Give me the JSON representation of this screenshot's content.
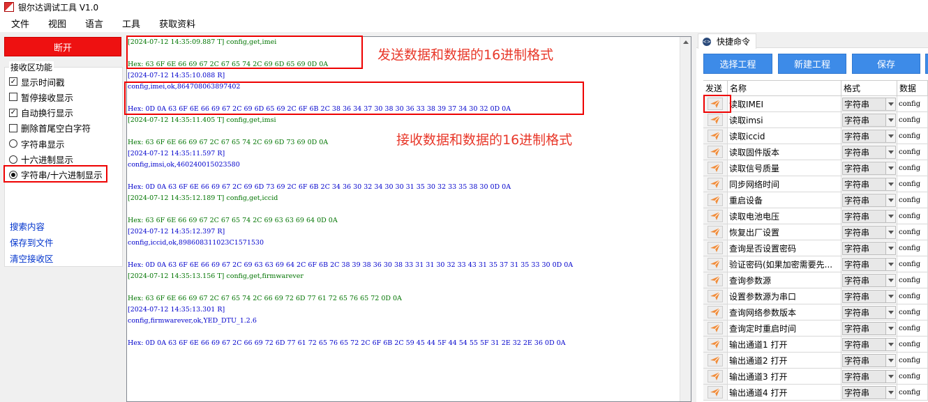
{
  "window": {
    "title": "银尔达调试工具 V1.0"
  },
  "menu": [
    "文件",
    "视图",
    "语言",
    "工具",
    "获取资料"
  ],
  "left": {
    "disconnect_label": "断开",
    "recv_group_title": "接收区功能",
    "options": [
      {
        "kind": "checkbox",
        "label": "显示时间戳",
        "checked": true
      },
      {
        "kind": "checkbox",
        "label": "暂停接收显示",
        "checked": false
      },
      {
        "kind": "checkbox",
        "label": "自动换行显示",
        "checked": true
      },
      {
        "kind": "checkbox",
        "label": "删除首尾空白字符",
        "checked": false
      },
      {
        "kind": "radio",
        "label": "字符串显示",
        "checked": false
      },
      {
        "kind": "radio",
        "label": "十六进制显示",
        "checked": false
      },
      {
        "kind": "radio",
        "label": "字符串/十六进制显示",
        "checked": true
      }
    ],
    "links": [
      "搜索内容",
      "保存到文件",
      "清空接收区"
    ]
  },
  "log": [
    {
      "type": "send",
      "text": "[2024-07-12 14:35:09.887 T] config,get,imei"
    },
    {
      "type": "blank",
      "text": ""
    },
    {
      "type": "send",
      "text": "Hex: 63 6F 6E 66 69 67 2C 67 65 74 2C 69 6D 65 69 0D 0A"
    },
    {
      "type": "recv",
      "text": "[2024-07-12 14:35:10.088 R]"
    },
    {
      "type": "recv",
      "text": "config,imei,ok,864708063897402"
    },
    {
      "type": "blank",
      "text": ""
    },
    {
      "type": "recv",
      "text": "Hex: 0D 0A 63 6F 6E 66 69 67 2C 69 6D 65 69 2C 6F 6B 2C 38 36 34 37 30 38 30 36 33 38 39 37 34 30 32 0D 0A"
    },
    {
      "type": "send",
      "text": "[2024-07-12 14:35:11.405 T] config,get,imsi"
    },
    {
      "type": "blank",
      "text": ""
    },
    {
      "type": "send",
      "text": "Hex: 63 6F 6E 66 69 67 2C 67 65 74 2C 69 6D 73 69 0D 0A"
    },
    {
      "type": "recv",
      "text": "[2024-07-12 14:35:11.597 R]"
    },
    {
      "type": "recv",
      "text": "config,imsi,ok,460240015023580"
    },
    {
      "type": "blank",
      "text": ""
    },
    {
      "type": "recv",
      "text": "Hex: 0D 0A 63 6F 6E 66 69 67 2C 69 6D 73 69 2C 6F 6B 2C 34 36 30 32 34 30 30 31 35 30 32 33 35 38 30 0D 0A"
    },
    {
      "type": "send",
      "text": "[2024-07-12 14:35:12.189 T] config,get,iccid"
    },
    {
      "type": "blank",
      "text": ""
    },
    {
      "type": "send",
      "text": "Hex: 63 6F 6E 66 69 67 2C 67 65 74 2C 69 63 63 69 64 0D 0A"
    },
    {
      "type": "recv",
      "text": "[2024-07-12 14:35:12.397 R]"
    },
    {
      "type": "recv",
      "text": "config,iccid,ok,898608311023C1571530"
    },
    {
      "type": "blank",
      "text": ""
    },
    {
      "type": "recv",
      "text": "Hex: 0D 0A 63 6F 6E 66 69 67 2C 69 63 63 69 64 2C 6F 6B 2C 38 39 38 36 30 38 33 31 31 30 32 33 43 31 35 37 31 35 33 30 0D 0A"
    },
    {
      "type": "send",
      "text": "[2024-07-12 14:35:13.156 T] config,get,firmwarever"
    },
    {
      "type": "blank",
      "text": ""
    },
    {
      "type": "send",
      "text": "Hex: 63 6F 6E 66 69 67 2C 67 65 74 2C 66 69 72 6D 77 61 72 65 76 65 72 0D 0A"
    },
    {
      "type": "recv",
      "text": "[2024-07-12 14:35:13.301 R]"
    },
    {
      "type": "recv",
      "text": "config,firmwarever,ok,YED_DTU_1.2.6"
    },
    {
      "type": "blank",
      "text": ""
    },
    {
      "type": "recv",
      "text": "Hex: 0D 0A 63 6F 6E 66 69 67 2C 66 69 72 6D 77 61 72 65 76 65 72 2C 6F 6B 2C 59 45 44 5F 44 54 55 5F 31 2E 32 2E 36 0D 0A"
    }
  ],
  "annotations": {
    "send_note": "发送数据和数据的16进制格式",
    "recv_note": "接收数据和数据的16进制格式"
  },
  "quick": {
    "tab_label": "快捷命令",
    "buttons": [
      "选择工程",
      "新建工程",
      "保存"
    ],
    "headers": [
      "发送",
      "名称",
      "格式",
      "数据"
    ],
    "rows": [
      {
        "name": "读取IMEI",
        "format": "字符串",
        "data": "config"
      },
      {
        "name": "读取imsi",
        "format": "字符串",
        "data": "config"
      },
      {
        "name": "读取iccid",
        "format": "字符串",
        "data": "config"
      },
      {
        "name": "读取固件版本",
        "format": "字符串",
        "data": "config"
      },
      {
        "name": "读取信号质量",
        "format": "字符串",
        "data": "config"
      },
      {
        "name": "同步网络时间",
        "format": "字符串",
        "data": "config"
      },
      {
        "name": "重启设备",
        "format": "字符串",
        "data": "config"
      },
      {
        "name": "读取电池电压",
        "format": "字符串",
        "data": "config"
      },
      {
        "name": "恢复出厂设置",
        "format": "字符串",
        "data": "config"
      },
      {
        "name": "查询是否设置密码",
        "format": "字符串",
        "data": "config"
      },
      {
        "name": "验证密码(如果加密需要先...",
        "format": "字符串",
        "data": "config"
      },
      {
        "name": "查询参数源",
        "format": "字符串",
        "data": "config"
      },
      {
        "name": "设置参数源为串口",
        "format": "字符串",
        "data": "config"
      },
      {
        "name": "查询网络参数版本",
        "format": "字符串",
        "data": "config"
      },
      {
        "name": "查询定时重启时间",
        "format": "字符串",
        "data": "config"
      },
      {
        "name": "输出通道1 打开",
        "format": "字符串",
        "data": "config"
      },
      {
        "name": "输出通道2 打开",
        "format": "字符串",
        "data": "config"
      },
      {
        "name": "输出通道3 打开",
        "format": "字符串",
        "data": "config"
      },
      {
        "name": "输出通道4 打开",
        "format": "字符串",
        "data": "config"
      }
    ]
  },
  "colors": {
    "disconnect_bg": "#ee1111",
    "button_blue": "#3d8be8",
    "send_text": "#007400",
    "recv_text": "#0000cc",
    "annotation": "#e8382a",
    "send_icon": "#f08c3a"
  }
}
